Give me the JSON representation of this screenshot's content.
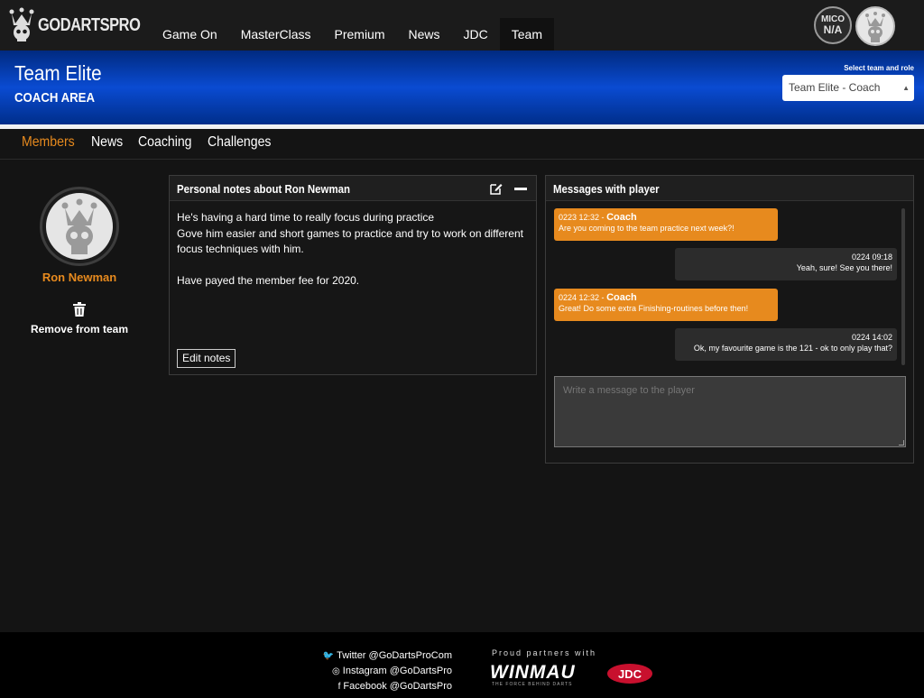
{
  "brand": {
    "logo_text": "GODARTSPRO"
  },
  "nav": {
    "items": [
      {
        "label": "Game On",
        "active": false
      },
      {
        "label": "MasterClass",
        "active": false
      },
      {
        "label": "Premium",
        "active": false
      },
      {
        "label": "News",
        "active": false
      },
      {
        "label": "JDC",
        "active": false
      },
      {
        "label": "Team",
        "active": true
      }
    ],
    "level_badge": {
      "line1": "MICO",
      "line2": "N/A"
    }
  },
  "header": {
    "team_name": "Team Elite",
    "area": "COACH AREA",
    "select_label": "Select team and role",
    "select_value": "Team Elite - Coach"
  },
  "subnav": {
    "items": [
      {
        "label": "Members",
        "active": true
      },
      {
        "label": "News",
        "active": false
      },
      {
        "label": "Coaching",
        "active": false
      },
      {
        "label": "Challenges",
        "active": false
      }
    ]
  },
  "player": {
    "name": "Ron Newman",
    "remove_label": "Remove from team"
  },
  "notes": {
    "title": "Personal notes about Ron Newman",
    "body": "He's having a hard time to really focus during practice\nGove him easier and short games to practice and try to work on different focus techniques with him.\n\nHave payed the member fee for 2020.",
    "edit_button": "Edit notes"
  },
  "messages": {
    "title": "Messages with player",
    "items": [
      {
        "from": "coach",
        "time": "0223 12:32 -",
        "author": "Coach",
        "text": "Are you coming to the team practice next week?!"
      },
      {
        "from": "player",
        "time": "0224 09:18",
        "author": "",
        "text": "Yeah, sure! See you there!"
      },
      {
        "from": "coach",
        "time": "0224 12:32 -",
        "author": "Coach",
        "text": "Great! Do some extra Finishing-routines before then!"
      },
      {
        "from": "player",
        "time": "0224 14:02",
        "author": "",
        "text": "Ok, my favourite game is the 121 - ok to only play that?"
      }
    ],
    "input_placeholder": "Write a message to the player"
  },
  "footer": {
    "twitter": "Twitter @GoDartsProCom",
    "instagram": "Instagram @GoDartsPro",
    "facebook": "Facebook @GoDartsPro",
    "partners_label": "Proud partners with",
    "winmau": "WINMAU",
    "winmau_tagline": "THE FORCE BEHIND DARTS",
    "jdc": "JDC"
  },
  "colors": {
    "accent": "#e78a1e",
    "header_blue": "#0a4bd2",
    "background": "#141414"
  }
}
